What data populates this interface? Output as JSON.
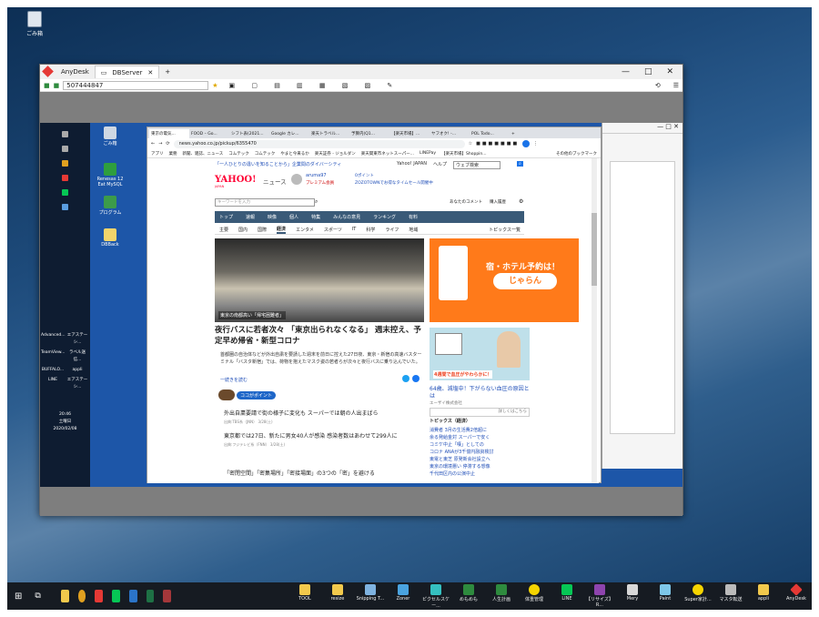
{
  "desktop": {
    "recycle_label": "ごみ箱"
  },
  "anydesk": {
    "app_name": "AnyDesk",
    "tab_label": "DBServer",
    "new_tab": "+",
    "address": "507444847",
    "controls": {
      "minimize": "—",
      "maximize": "□",
      "close": "✕"
    }
  },
  "remote": {
    "taskbar_time": "20:46",
    "taskbar_day": "土曜日",
    "taskbar_date": "2020/02/08",
    "icons": [
      {
        "label": "ごみ箱",
        "color": "#cfd8e3"
      },
      {
        "label": "Renesas 12 Eat MySQL",
        "color": "#2e9e3e"
      },
      {
        "label": "プログラム",
        "color": "#3c9b4a"
      },
      {
        "label": "DBBack",
        "color": "#f2d46b"
      }
    ],
    "left_icons": [
      "Advanced...",
      "エアステーシ...",
      "TeamView...",
      "ラベル送信...",
      "BUFFALO...",
      "appli",
      "LINE",
      "エアステーシ..."
    ]
  },
  "chrome": {
    "tabs": [
      "東京の電気...",
      "FOOD – Go...",
      "シフト表(2021...",
      "Google カレ...",
      "楽天トラベル...",
      "予算内(Q1...",
      "【楽天市場】...",
      "ヤフオク! -...",
      "POL Todo...",
      "+"
    ],
    "url": "news.yahoo.co.jp/pickup/6355470",
    "bookmarks": [
      "アプリ",
      "業務",
      "新聞、雑誌、ニュース",
      "コムテック",
      "コムテック",
      "やまと今来るか",
      "楽天証券 - ジョルダン",
      "楽天関東市ネットスーパー...",
      "LINEPay",
      "【楽天市場】Shoppin...",
      "その他のブックマーク"
    ]
  },
  "yahoo": {
    "top_banner": "「一人ひとりの違いを知ることから」企業間のダイバーシティ",
    "yahoo_japan": "Yahoo! JAPAN",
    "help": "ヘルプ",
    "web_search": "ウェブ検索",
    "logo": "YAHOO!",
    "logo_sub": "JAPAN",
    "news_label": "ニュース",
    "user": "aruma97",
    "premium": "プレミアム会員",
    "points": "0ポイント",
    "zozo": "ZOZOTOWNでお得なタイムセール開催中",
    "search_placeholder": "キーワードを入力",
    "for_you": "あなたのコメント",
    "buy_history": "購入履歴",
    "nav": [
      "トップ",
      "速報",
      "映像",
      "個人",
      "特集",
      "みんなの意見",
      "ランキング",
      "有料"
    ],
    "sub_nav": [
      "主要",
      "国内",
      "国際",
      "経済",
      "エンタメ",
      "スポーツ",
      "IT",
      "科学",
      "ライフ",
      "地域"
    ],
    "topics_list_link": "トピックス一覧",
    "photo_caption": "東京の南都高い「帰宅困難者」",
    "headline": "夜行バスに若者次々 「東京出られなくなる」 週末控え、予定早め帰省・新型コロナ",
    "body": "首都圏の自治体などが外出自粛を要請した週末を前日に控えた27日夜、東京・新宿の高速バスターミナル「バスタ新宿」では、荷物を抱えたマスク姿の若者らが次々と夜行バスに乗り込んでいた。",
    "continue": "一続きを読む",
    "coco_point": "ココがポイント",
    "articles": [
      {
        "title": "外出自粛要請で街の様子に変化も スーパーでは朝の人出まばら",
        "meta": "出典:TBS系（JNN） 3/28(土)"
      },
      {
        "title": "東京都では27日、新たに男女40人が感染 感染者数はあわせて299人に",
        "meta": "出典:フジテレビ系（FNN） 3/28(土)"
      },
      {
        "title": "「密閉空間」「密集場所」「密接場面」の3つの「密」を避ける",
        "meta": ""
      }
    ],
    "ad1_title": "宿・ホテル予約は！",
    "ad1_logo": "じゃらん",
    "ad2_banner": "4週間で血圧がやわらかに！",
    "ad2_text": "64歳、減塩中！下がらない血圧の原因とは",
    "ad2_source": "エーザイ株式会社",
    "ad2_more": "詳しくはこちら",
    "topics_header": "トピックス（経済）",
    "topics": [
      "消費者 3月の生活費2倍超に",
      "余る発給金対 スーパーで安く",
      "コミケ中止「嘆」としての",
      "コロナ ANAが3千億円融資検討",
      "東電と東芝 原発新会社設立へ",
      "東京の環境悪い 停滞する想像",
      "千代田区内の公演中止"
    ]
  },
  "taskbar": {
    "pinned": [
      "file-explorer",
      "chrome",
      "anydesk",
      "line",
      "outlook",
      "excel",
      "access"
    ],
    "apps": [
      {
        "label": "TOOL",
        "color": "#f2c94c"
      },
      {
        "label": "resize",
        "color": "#f2c94c"
      },
      {
        "label": "Snipping T...",
        "color": "#7fb3e0"
      },
      {
        "label": "Zoner",
        "color": "#4aa3df"
      },
      {
        "label": "ピクセルスケー...",
        "color": "#35c0c0"
      },
      {
        "label": "めもめも",
        "color": "#2e8b3e"
      },
      {
        "label": "人生計画",
        "color": "#2e8b3e"
      },
      {
        "label": "体重管理",
        "color": "#f5d400"
      },
      {
        "label": "LINE",
        "color": "#06c755"
      },
      {
        "label": "【リサイズ】R...",
        "color": "#8e44ad"
      },
      {
        "label": "Mery",
        "color": "#d8d8d8"
      },
      {
        "label": "Paint",
        "color": "#7ec7e8"
      },
      {
        "label": "Super家計...",
        "color": "#f5d400"
      },
      {
        "label": "マスタ転送",
        "color": "#bbbbbb"
      },
      {
        "label": "appli",
        "color": "#f2c94c"
      },
      {
        "label": "AnyDesk",
        "color": "#e53935"
      }
    ]
  }
}
